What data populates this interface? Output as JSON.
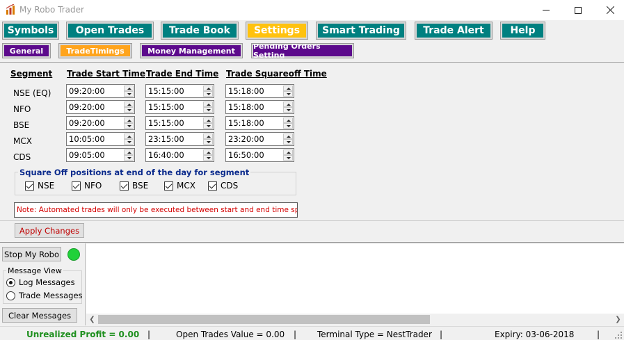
{
  "window": {
    "title": "My Robo Trader",
    "controls": [
      "minimize-icon",
      "maximize-icon",
      "close-icon"
    ]
  },
  "main_menu": [
    {
      "label": "Symbols"
    },
    {
      "label": "Open Trades"
    },
    {
      "label": "Trade Book"
    },
    {
      "label": "Settings",
      "active": true
    },
    {
      "label": "Smart Trading"
    },
    {
      "label": "Trade Alert"
    },
    {
      "label": "Help"
    }
  ],
  "sub_menu": [
    {
      "label": "General"
    },
    {
      "label": "TradeTimings",
      "active": true
    },
    {
      "label": "Money Management"
    },
    {
      "label": "Pending Orders Setting"
    }
  ],
  "timings": {
    "headers": {
      "segment": "Segment",
      "start": "Trade Start Time",
      "end": "Trade End Time",
      "squareoff": "Trade Squareoff Time"
    },
    "rows": [
      {
        "segment": "NSE (EQ)",
        "start": "09:20:00",
        "end": "15:15:00",
        "squareoff": "15:18:00"
      },
      {
        "segment": "NFO",
        "start": "09:20:00",
        "end": "15:15:00",
        "squareoff": "15:18:00"
      },
      {
        "segment": "BSE",
        "start": "09:20:00",
        "end": "15:15:00",
        "squareoff": "15:18:00"
      },
      {
        "segment": "MCX",
        "start": "10:05:00",
        "end": "23:15:00",
        "squareoff": "23:20:00"
      },
      {
        "segment": "CDS",
        "start": "09:05:00",
        "end": "16:40:00",
        "squareoff": "16:50:00"
      }
    ]
  },
  "square_off": {
    "title": "Square Off positions at end of the day for segment",
    "items": [
      {
        "label": "NSE",
        "checked": true
      },
      {
        "label": "NFO",
        "checked": true
      },
      {
        "label": "BSE",
        "checked": true
      },
      {
        "label": "MCX",
        "checked": true
      },
      {
        "label": "CDS",
        "checked": true
      }
    ]
  },
  "note": "Note: Automated trades will only be executed between start and end time specified.",
  "apply_label": "Apply Changes",
  "robo": {
    "stop_label": "Stop My Robo",
    "status_color": "#21d13a"
  },
  "message_view": {
    "title": "Message View",
    "options": [
      {
        "label": "Log Messages",
        "selected": true
      },
      {
        "label": "Trade Messages",
        "selected": false
      }
    ],
    "clear_label": "Clear Messages"
  },
  "status": {
    "profit": "Unrealized Profit = 0.00",
    "sep": "|",
    "open_value": "Open Trades Value = 0.00",
    "terminal": "Terminal Type = NestTrader",
    "expiry": "Expiry: 03-06-2018"
  },
  "colors": {
    "main_button": "#008080",
    "main_active": "#ffc20e",
    "sub_button": "#5c0a8c",
    "sub_active": "#ffa41c",
    "note_text": "#d40000"
  }
}
